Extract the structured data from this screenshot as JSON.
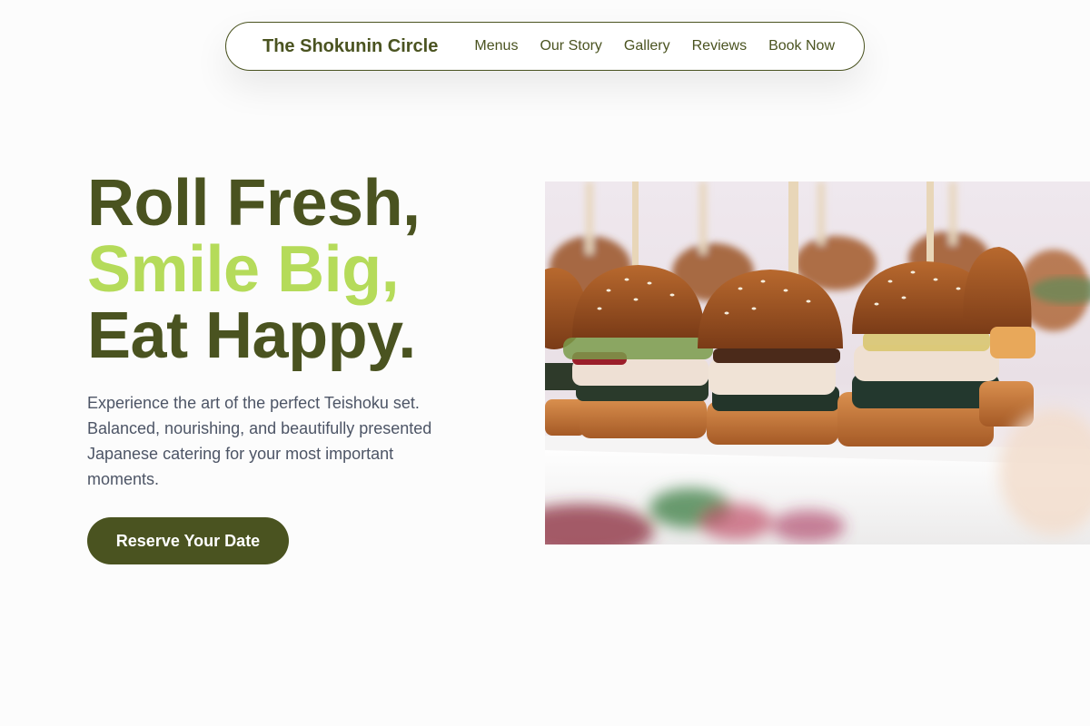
{
  "nav": {
    "brand": "The Shokunin Circle",
    "links": [
      "Menus",
      "Our Story",
      "Gallery",
      "Reviews",
      "Book Now"
    ]
  },
  "hero": {
    "title_line1": "Roll Fresh,",
    "title_line2": "Smile Big,",
    "title_line3": "Eat Happy.",
    "description": "Experience the art of the perfect Teishoku set. Balanced, nourishing, and beautifully presented Japanese catering for your most important moments.",
    "cta_label": "Reserve Your Date",
    "image_alt": "Mini sliders on skewers served on a white platter"
  },
  "colors": {
    "brand_olive": "#4a5320",
    "accent_lime": "#b5db5a",
    "body_text": "#4d5566",
    "background": "#fcfcfc"
  }
}
